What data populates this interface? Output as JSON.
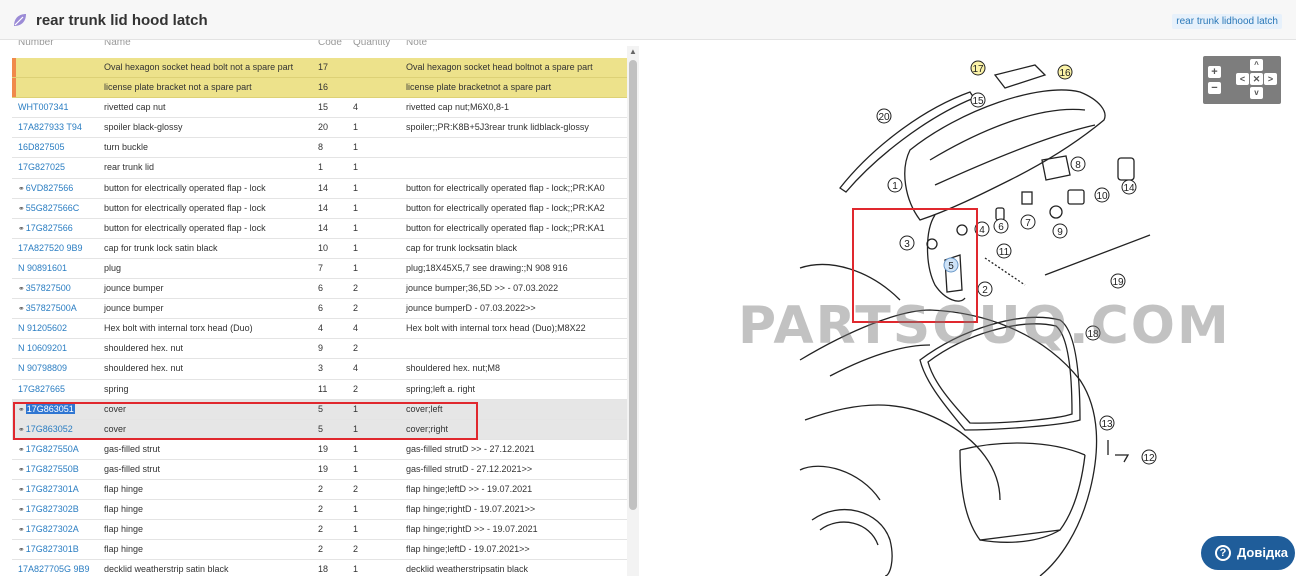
{
  "header": {
    "title": "rear trunk lid hood latch",
    "breadcrumb": "rear trunk lidhood latch"
  },
  "table": {
    "columns": [
      "Number",
      "Name",
      "Code",
      "Quantity",
      "Note"
    ],
    "rows": [
      {
        "number": "",
        "name": "Oval hexagon socket head bolt not a spare part",
        "code": "17",
        "qty": "",
        "note": "Oval hexagon socket head boltnot a spare part",
        "style": "yellow"
      },
      {
        "number": "",
        "name": "license plate bracket not a spare part",
        "code": "16",
        "qty": "",
        "note": "license plate bracketnot a spare part",
        "style": "yellow"
      },
      {
        "number": "WHT007341",
        "name": "rivetted cap nut",
        "code": "15",
        "qty": "4",
        "note": "rivetted cap nut;M6X0,8-1"
      },
      {
        "number": "17A827933 T94",
        "name": "spoiler black-glossy",
        "code": "20",
        "qty": "1",
        "note": "spoiler;;PR:K8B+5J3rear trunk lidblack-glossy"
      },
      {
        "number": "16D827505",
        "name": "turn buckle",
        "code": "8",
        "qty": "1",
        "note": ""
      },
      {
        "number": "17G827025",
        "name": "rear trunk lid",
        "code": "1",
        "qty": "1",
        "note": ""
      },
      {
        "number": "6VD827566",
        "name": "button for electrically operated flap - lock",
        "code": "14",
        "qty": "1",
        "note": "button for electrically operated flap - lock;;PR:KA0",
        "link": true
      },
      {
        "number": "55G827566C",
        "name": "button for electrically operated flap - lock",
        "code": "14",
        "qty": "1",
        "note": "button for electrically operated flap - lock;;PR:KA2",
        "link": true
      },
      {
        "number": "17G827566",
        "name": "button for electrically operated flap - lock",
        "code": "14",
        "qty": "1",
        "note": "button for electrically operated flap - lock;;PR:KA1",
        "link": true
      },
      {
        "number": "17A827520 9B9",
        "name": "cap for trunk lock satin black",
        "code": "10",
        "qty": "1",
        "note": "cap for trunk locksatin black"
      },
      {
        "number": "N 90891601",
        "name": "plug",
        "code": "7",
        "qty": "1",
        "note": "plug;18X45X5,7 see drawing:;N 908 916"
      },
      {
        "number": "357827500",
        "name": "jounce bumper",
        "code": "6",
        "qty": "2",
        "note": "jounce bumper;36,5D >> - 07.03.2022",
        "link": true
      },
      {
        "number": "357827500A",
        "name": "jounce bumper",
        "code": "6",
        "qty": "2",
        "note": "jounce bumperD - 07.03.2022>>",
        "link": true
      },
      {
        "number": "N 91205602",
        "name": "Hex bolt with internal torx head (Duo)",
        "code": "4",
        "qty": "4",
        "note": "Hex bolt with internal torx head (Duo);M8X22"
      },
      {
        "number": "N 10609201",
        "name": "shouldered hex. nut",
        "code": "9",
        "qty": "2",
        "note": ""
      },
      {
        "number": "N 90798809",
        "name": "shouldered hex. nut",
        "code": "3",
        "qty": "4",
        "note": "shouldered hex. nut;M8"
      },
      {
        "number": "17G827665",
        "name": "spring",
        "code": "11",
        "qty": "2",
        "note": "spring;left a. right"
      },
      {
        "number": "17G863051",
        "name": "cover",
        "code": "5",
        "qty": "1",
        "note": "cover;left",
        "link": true,
        "style": "grey",
        "selected": true
      },
      {
        "number": "17G863052",
        "name": "cover",
        "code": "5",
        "qty": "1",
        "note": "cover;right",
        "link": true,
        "style": "grey"
      },
      {
        "number": "17G827550A",
        "name": "gas-filled strut",
        "code": "19",
        "qty": "1",
        "note": "gas-filled strutD >> - 27.12.2021",
        "link": true
      },
      {
        "number": "17G827550B",
        "name": "gas-filled strut",
        "code": "19",
        "qty": "1",
        "note": "gas-filled strutD - 27.12.2021>>",
        "link": true
      },
      {
        "number": "17G827301A",
        "name": "flap hinge",
        "code": "2",
        "qty": "2",
        "note": "flap hinge;leftD >> - 19.07.2021",
        "link": true
      },
      {
        "number": "17G827302B",
        "name": "flap hinge",
        "code": "2",
        "qty": "1",
        "note": "flap hinge;rightD - 19.07.2021>>",
        "link": true
      },
      {
        "number": "17G827302A",
        "name": "flap hinge",
        "code": "2",
        "qty": "1",
        "note": "flap hinge;rightD >> - 19.07.2021",
        "link": true
      },
      {
        "number": "17G827301B",
        "name": "flap hinge",
        "code": "2",
        "qty": "2",
        "note": "flap hinge;leftD - 19.07.2021>>",
        "link": true
      },
      {
        "number": "17A827705G 9B9",
        "name": "decklid weatherstrip satin black",
        "code": "18",
        "qty": "1",
        "note": "decklid weatherstripsatin black"
      }
    ]
  },
  "diagram": {
    "watermark": "PARTSOUQ.COM",
    "callouts": [
      "1",
      "2",
      "3",
      "4",
      "5",
      "6",
      "7",
      "8",
      "9",
      "10",
      "11",
      "12",
      "13",
      "14",
      "15",
      "16",
      "17",
      "18",
      "19",
      "20"
    ]
  },
  "zoom_controls": {
    "plus": "+",
    "minus": "−",
    "up": "^",
    "down": "v",
    "left": "<",
    "right": ">",
    "reset": "✕"
  },
  "help_button": {
    "label": "Довідка"
  },
  "colors": {
    "link": "#2a7dc2",
    "highlight_yellow": "#ede28b",
    "accent_orange": "#f08a4b",
    "selection": "#2f76d2",
    "red_frame": "#e0282e",
    "help_bg": "#1f5d9a"
  }
}
